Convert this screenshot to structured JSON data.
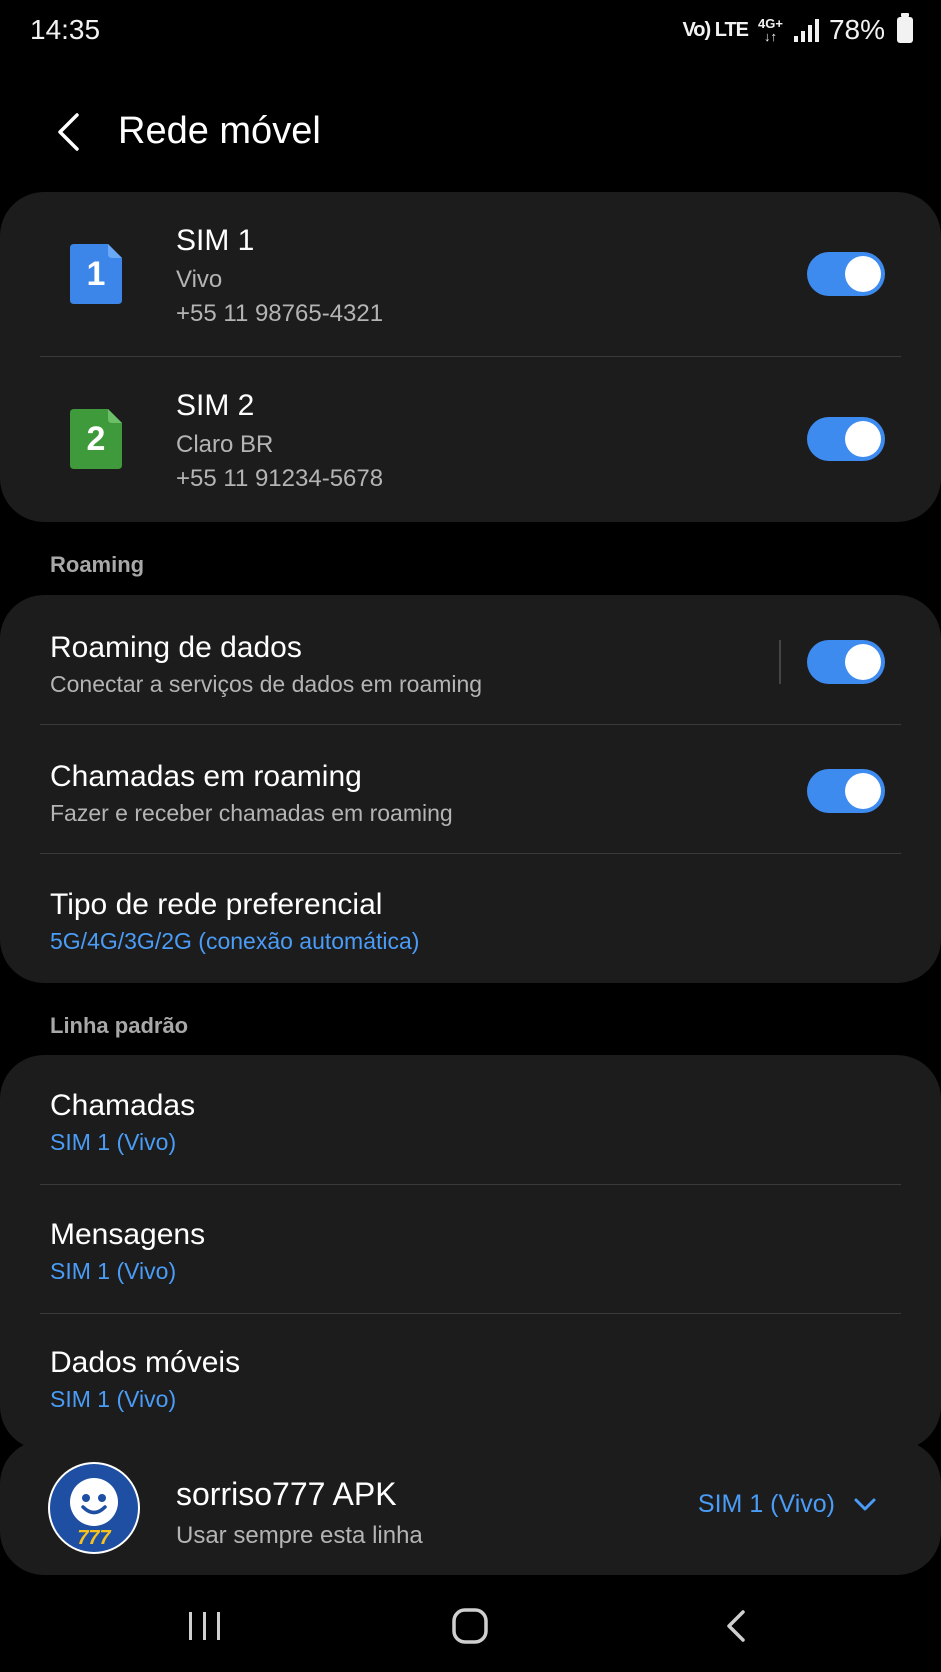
{
  "status_bar": {
    "time": "14:35",
    "network_1": "Vo) LTE",
    "network_2_top": "4G+",
    "network_2_bottom": "↓↑",
    "battery": "78%"
  },
  "header": {
    "title": "Rede móvel",
    "back_icon": "chevron-left-icon"
  },
  "sims": [
    {
      "badge": "1",
      "name": "SIM 1",
      "carrier": "Vivo",
      "number": "+55 11 98765-4321",
      "enabled": true,
      "color": "#3b86e8"
    },
    {
      "badge": "2",
      "name": "SIM 2",
      "carrier": "Claro BR",
      "number": "+55 11 91234-5678",
      "enabled": true,
      "color": "#3f9a3c"
    }
  ],
  "roaming": {
    "header": "Roaming",
    "items": [
      {
        "title": "Roaming de dados",
        "subtitle": "Conectar a serviços de dados em roaming",
        "enabled": true
      },
      {
        "title": "Chamadas em roaming",
        "subtitle": "Fazer e receber chamadas em roaming",
        "enabled": true
      },
      {
        "title": "Tipo de rede preferencial",
        "subtitle": "5G/4G/3G/2G (conexão automática)"
      }
    ]
  },
  "default_line": {
    "header": "Linha padrão",
    "items": [
      {
        "title": "Chamadas",
        "value": "SIM 1 (Vivo)"
      },
      {
        "title": "Mensagens",
        "value": "SIM 1 (Vivo)"
      },
      {
        "title": "Dados móveis",
        "value": "SIM 1 (Vivo)"
      }
    ]
  },
  "app_line": {
    "app_name": "sorriso777 APK",
    "subtitle": "Usar sempre esta linha",
    "selected": "SIM 1 (Vivo)",
    "logo_text": "777"
  },
  "colors": {
    "accent": "#3e8bf0",
    "link": "#4a9cf6",
    "card": "#1c1c1c",
    "background": "#000000"
  },
  "nav_icons": [
    "recents-icon",
    "home-icon",
    "back-icon"
  ]
}
